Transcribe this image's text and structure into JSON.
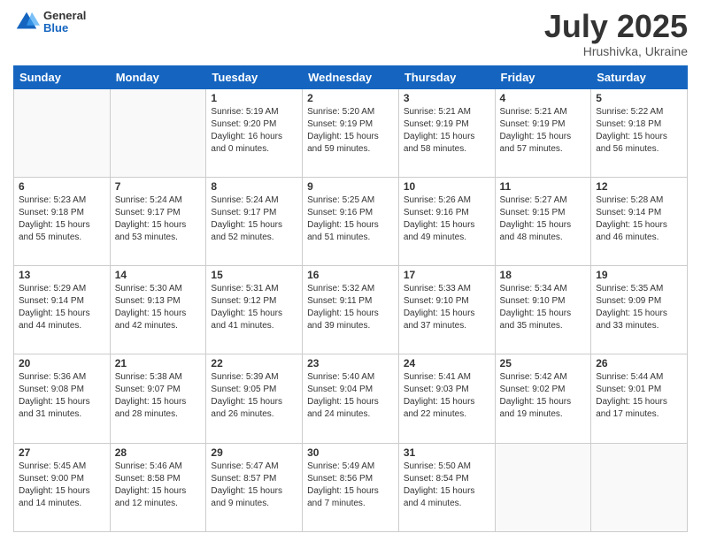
{
  "header": {
    "logo": {
      "general": "General",
      "blue": "Blue"
    },
    "title": "July 2025",
    "location": "Hrushivka, Ukraine"
  },
  "calendar": {
    "days_of_week": [
      "Sunday",
      "Monday",
      "Tuesday",
      "Wednesday",
      "Thursday",
      "Friday",
      "Saturday"
    ],
    "weeks": [
      [
        {
          "day": "",
          "info": ""
        },
        {
          "day": "",
          "info": ""
        },
        {
          "day": "1",
          "info": "Sunrise: 5:19 AM\nSunset: 9:20 PM\nDaylight: 16 hours\nand 0 minutes."
        },
        {
          "day": "2",
          "info": "Sunrise: 5:20 AM\nSunset: 9:19 PM\nDaylight: 15 hours\nand 59 minutes."
        },
        {
          "day": "3",
          "info": "Sunrise: 5:21 AM\nSunset: 9:19 PM\nDaylight: 15 hours\nand 58 minutes."
        },
        {
          "day": "4",
          "info": "Sunrise: 5:21 AM\nSunset: 9:19 PM\nDaylight: 15 hours\nand 57 minutes."
        },
        {
          "day": "5",
          "info": "Sunrise: 5:22 AM\nSunset: 9:18 PM\nDaylight: 15 hours\nand 56 minutes."
        }
      ],
      [
        {
          "day": "6",
          "info": "Sunrise: 5:23 AM\nSunset: 9:18 PM\nDaylight: 15 hours\nand 55 minutes."
        },
        {
          "day": "7",
          "info": "Sunrise: 5:24 AM\nSunset: 9:17 PM\nDaylight: 15 hours\nand 53 minutes."
        },
        {
          "day": "8",
          "info": "Sunrise: 5:24 AM\nSunset: 9:17 PM\nDaylight: 15 hours\nand 52 minutes."
        },
        {
          "day": "9",
          "info": "Sunrise: 5:25 AM\nSunset: 9:16 PM\nDaylight: 15 hours\nand 51 minutes."
        },
        {
          "day": "10",
          "info": "Sunrise: 5:26 AM\nSunset: 9:16 PM\nDaylight: 15 hours\nand 49 minutes."
        },
        {
          "day": "11",
          "info": "Sunrise: 5:27 AM\nSunset: 9:15 PM\nDaylight: 15 hours\nand 48 minutes."
        },
        {
          "day": "12",
          "info": "Sunrise: 5:28 AM\nSunset: 9:14 PM\nDaylight: 15 hours\nand 46 minutes."
        }
      ],
      [
        {
          "day": "13",
          "info": "Sunrise: 5:29 AM\nSunset: 9:14 PM\nDaylight: 15 hours\nand 44 minutes."
        },
        {
          "day": "14",
          "info": "Sunrise: 5:30 AM\nSunset: 9:13 PM\nDaylight: 15 hours\nand 42 minutes."
        },
        {
          "day": "15",
          "info": "Sunrise: 5:31 AM\nSunset: 9:12 PM\nDaylight: 15 hours\nand 41 minutes."
        },
        {
          "day": "16",
          "info": "Sunrise: 5:32 AM\nSunset: 9:11 PM\nDaylight: 15 hours\nand 39 minutes."
        },
        {
          "day": "17",
          "info": "Sunrise: 5:33 AM\nSunset: 9:10 PM\nDaylight: 15 hours\nand 37 minutes."
        },
        {
          "day": "18",
          "info": "Sunrise: 5:34 AM\nSunset: 9:10 PM\nDaylight: 15 hours\nand 35 minutes."
        },
        {
          "day": "19",
          "info": "Sunrise: 5:35 AM\nSunset: 9:09 PM\nDaylight: 15 hours\nand 33 minutes."
        }
      ],
      [
        {
          "day": "20",
          "info": "Sunrise: 5:36 AM\nSunset: 9:08 PM\nDaylight: 15 hours\nand 31 minutes."
        },
        {
          "day": "21",
          "info": "Sunrise: 5:38 AM\nSunset: 9:07 PM\nDaylight: 15 hours\nand 28 minutes."
        },
        {
          "day": "22",
          "info": "Sunrise: 5:39 AM\nSunset: 9:05 PM\nDaylight: 15 hours\nand 26 minutes."
        },
        {
          "day": "23",
          "info": "Sunrise: 5:40 AM\nSunset: 9:04 PM\nDaylight: 15 hours\nand 24 minutes."
        },
        {
          "day": "24",
          "info": "Sunrise: 5:41 AM\nSunset: 9:03 PM\nDaylight: 15 hours\nand 22 minutes."
        },
        {
          "day": "25",
          "info": "Sunrise: 5:42 AM\nSunset: 9:02 PM\nDaylight: 15 hours\nand 19 minutes."
        },
        {
          "day": "26",
          "info": "Sunrise: 5:44 AM\nSunset: 9:01 PM\nDaylight: 15 hours\nand 17 minutes."
        }
      ],
      [
        {
          "day": "27",
          "info": "Sunrise: 5:45 AM\nSunset: 9:00 PM\nDaylight: 15 hours\nand 14 minutes."
        },
        {
          "day": "28",
          "info": "Sunrise: 5:46 AM\nSunset: 8:58 PM\nDaylight: 15 hours\nand 12 minutes."
        },
        {
          "day": "29",
          "info": "Sunrise: 5:47 AM\nSunset: 8:57 PM\nDaylight: 15 hours\nand 9 minutes."
        },
        {
          "day": "30",
          "info": "Sunrise: 5:49 AM\nSunset: 8:56 PM\nDaylight: 15 hours\nand 7 minutes."
        },
        {
          "day": "31",
          "info": "Sunrise: 5:50 AM\nSunset: 8:54 PM\nDaylight: 15 hours\nand 4 minutes."
        },
        {
          "day": "",
          "info": ""
        },
        {
          "day": "",
          "info": ""
        }
      ]
    ]
  }
}
